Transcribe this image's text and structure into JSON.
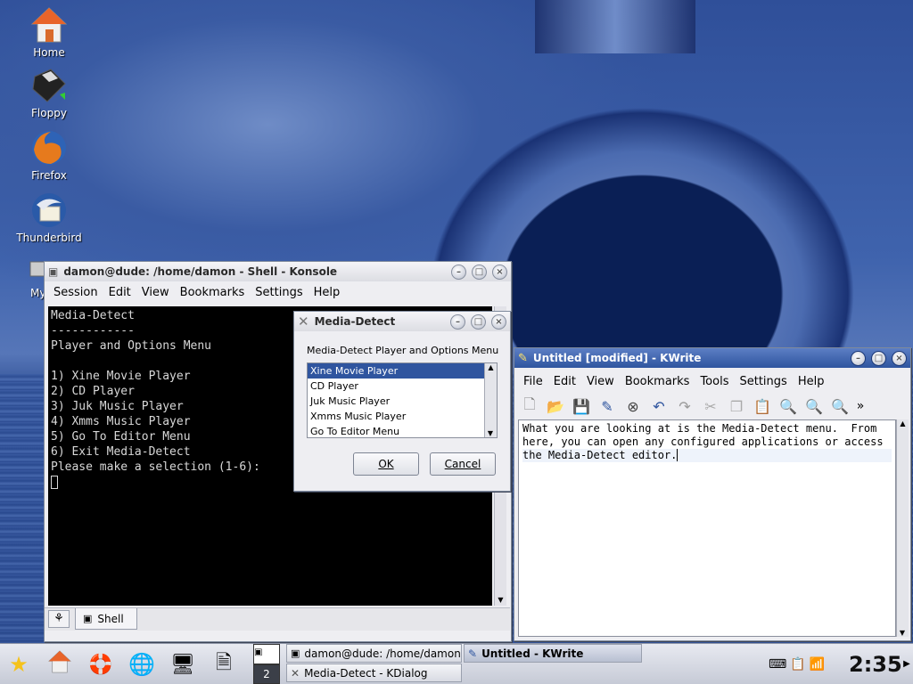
{
  "desktop": {
    "icons": [
      {
        "label": "Home",
        "icon": "home-icon"
      },
      {
        "label": "Floppy",
        "icon": "floppy-icon"
      },
      {
        "label": "Firefox",
        "icon": "firefox-icon"
      },
      {
        "label": "Thunderbird",
        "icon": "thunderbird-icon"
      },
      {
        "label": "My",
        "icon": "computer-icon"
      }
    ]
  },
  "konsole": {
    "title": "damon@dude: /home/damon - Shell - Konsole",
    "menu": [
      "Session",
      "Edit",
      "View",
      "Bookmarks",
      "Settings",
      "Help"
    ],
    "terminal_lines": [
      "Media-Detect",
      "------------",
      "Player and Options Menu",
      "",
      "1) Xine Movie Player",
      "2) CD Player",
      "3) Juk Music Player",
      "4) Xmms Music Player",
      "5) Go To Editor Menu",
      "6) Exit Media-Detect",
      "Please make a selection (1-6):"
    ],
    "tab_label": "Shell"
  },
  "dialog": {
    "title": "Media-Detect",
    "prompt": "Media-Detect Player and Options Menu",
    "items": [
      "Xine Movie Player",
      "CD Player",
      "Juk Music Player",
      "Xmms Music Player",
      "Go To Editor Menu"
    ],
    "selected_index": 0,
    "ok_label": "OK",
    "cancel_label": "Cancel"
  },
  "kwrite": {
    "title": "Untitled [modified] - KWrite",
    "menu": [
      "File",
      "Edit",
      "View",
      "Bookmarks",
      "Tools",
      "Settings",
      "Help"
    ],
    "text_lines": [
      "What you are looking at is the Media-Detect menu.  From",
      "here, you can open any configured applications or access",
      "the Media-Detect editor."
    ],
    "toolbar_icons": [
      "new-icon",
      "open-icon",
      "save-icon",
      "save-as-icon",
      "close-icon",
      "undo-icon",
      "redo-icon",
      "cut-icon",
      "copy-icon",
      "paste-icon",
      "find-icon",
      "zoom-in-icon",
      "zoom-out-icon",
      "more-icon"
    ]
  },
  "taskbar": {
    "pager_number": "2",
    "tasks": [
      {
        "label": "damon@dude: /home/damon",
        "icon": "terminal-icon"
      },
      {
        "label": "Media-Detect - KDialog",
        "icon": "kdialog-icon"
      },
      {
        "label": "Untitled - KWrite",
        "icon": "kwrite-icon"
      }
    ],
    "clock": "2:35"
  },
  "colors": {
    "accent": "#2f559f",
    "terminal_bg": "#000000",
    "terminal_fg": "#d8d8d8"
  }
}
